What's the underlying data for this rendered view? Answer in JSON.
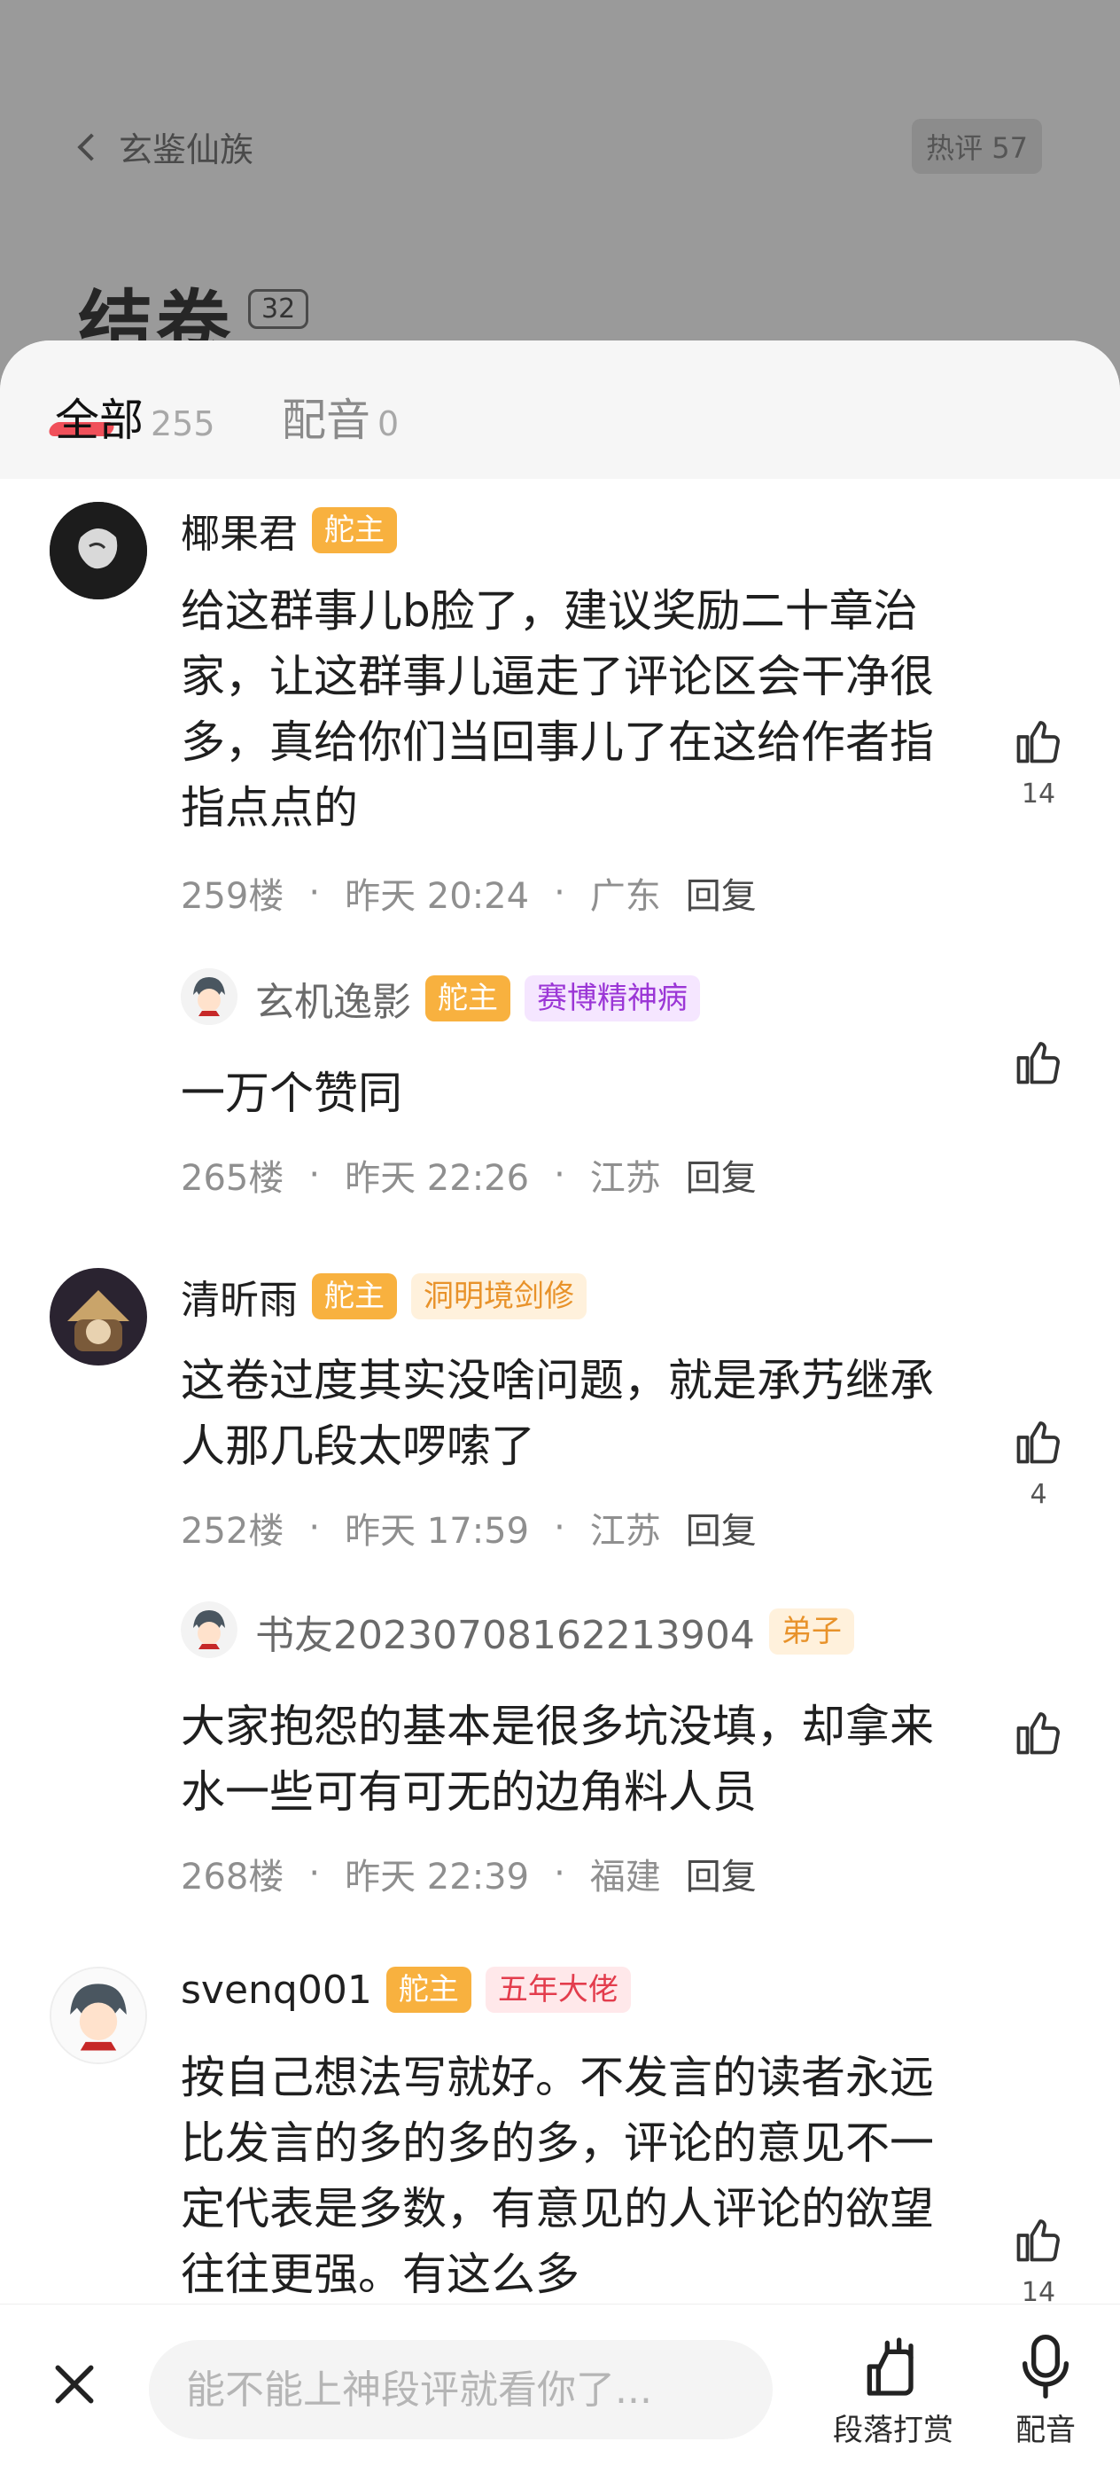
{
  "background_page": {
    "back_label": "玄鉴仙族",
    "hot_comments": "热评 57",
    "chapter_title": "结卷",
    "chapter_comment_count": "32"
  },
  "tabs": [
    {
      "label": "全部",
      "count": "255",
      "active": true
    },
    {
      "label": "配音",
      "count": "0",
      "active": false
    }
  ],
  "comments": [
    {
      "username": "椰果君",
      "badges": [
        "舵主"
      ],
      "text": "给这群事儿b脸了，建议奖励二十章治家，让这群事儿逼走了评论区会干净很多，真给你们当回事儿了在这给作者指指点点的",
      "floor": "259楼",
      "time": "昨天 20:24",
      "location": "广东",
      "reply": "回复",
      "likes": "14"
    },
    {
      "username": "玄机逸影",
      "badges": [
        "舵主",
        "赛博精神病"
      ],
      "text": "一万个赞同",
      "floor": "265楼",
      "time": "昨天 22:26",
      "location": "江苏",
      "reply": "回复",
      "likes": ""
    },
    {
      "username": "清昕雨",
      "badges": [
        "舵主",
        "洞明境剑修"
      ],
      "text": "这卷过度其实没啥问题，就是承艿继承人那几段太啰嗦了",
      "floor": "252楼",
      "time": "昨天 17:59",
      "location": "江苏",
      "reply": "回复",
      "likes": "4"
    },
    {
      "username": "书友20230708162213904",
      "badges": [
        "弟子"
      ],
      "text": "大家抱怨的基本是很多坑没填，却拿来水一些可有可无的边角料人员",
      "floor": "268楼",
      "time": "昨天 22:39",
      "location": "福建",
      "reply": "回复",
      "likes": ""
    },
    {
      "username": "svenq001",
      "badges": [
        "舵主",
        "五年大佬"
      ],
      "text": "按自己想法写就好。不发言的读者永远比发言的多的多的多，评论的意见不一定代表是多数，有意见的人评论的欲望往往更强。有这么多",
      "likes": "14"
    }
  ],
  "bottom_bar": {
    "input_placeholder": "能不能上神段评就看你了...",
    "tip_label": "段落打赏",
    "dub_label": "配音"
  },
  "colors": {
    "accent_red": "#f0505a",
    "helm_badge": "#f8b13f",
    "purple_badge_text": "#9b36d6",
    "gold_badge_text": "#e8922a",
    "red_badge_text": "#e33d4d",
    "dim_overlay": "#9a9a9a"
  },
  "icons": [
    "back-chevron-icon",
    "thumbs-up-icon",
    "close-icon",
    "hand-tip-icon",
    "microphone-icon"
  ]
}
